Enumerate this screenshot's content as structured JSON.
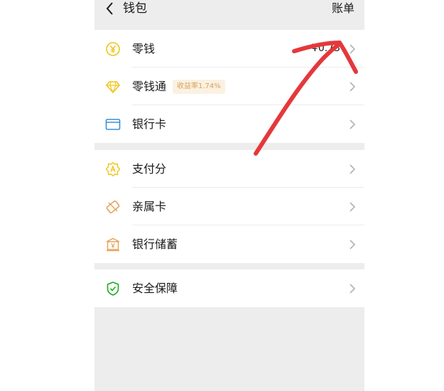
{
  "header": {
    "back_icon": "chevron-left-icon",
    "title": "钱包",
    "bill_label": "账单"
  },
  "groups": [
    {
      "items": [
        {
          "label": "零钱",
          "icon": "yuan-coin-icon",
          "amount": "¥0.73"
        },
        {
          "label": "零钱通",
          "icon": "diamond-icon",
          "badge": "收益率1.74%"
        },
        {
          "label": "银行卡",
          "icon": "bank-card-icon"
        }
      ]
    },
    {
      "items": [
        {
          "label": "支付分",
          "icon": "badge-a-icon"
        },
        {
          "label": "亲属卡",
          "icon": "family-card-icon"
        },
        {
          "label": "银行储蓄",
          "icon": "bank-savings-icon"
        }
      ]
    },
    {
      "items": [
        {
          "label": "安全保障",
          "icon": "shield-check-icon"
        }
      ]
    }
  ],
  "colors": {
    "yellow": "#f0c419",
    "blue": "#3a8fd6",
    "orange": "#e7a45a",
    "green": "#1aad19",
    "annotation_red": "#e5383b",
    "background": "#ededed"
  }
}
